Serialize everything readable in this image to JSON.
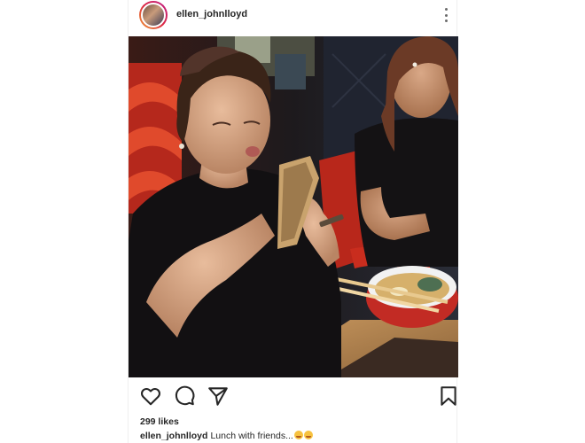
{
  "post": {
    "username": "ellen_johnlloyd",
    "likes_text": "299 likes",
    "caption_user": "ellen_johnlloyd",
    "caption_text": "Lunch with friends...",
    "caption_emojis": [
      "smiling-face-icon",
      "kissing-face-icon"
    ]
  },
  "actions": {
    "like": "heart-icon",
    "comment": "comment-bubble-icon",
    "share": "paper-plane-icon",
    "save": "bookmark-icon"
  },
  "colors": {
    "text": "#262626",
    "icon_stroke": "#262626",
    "story_ring": "#dc2743"
  }
}
